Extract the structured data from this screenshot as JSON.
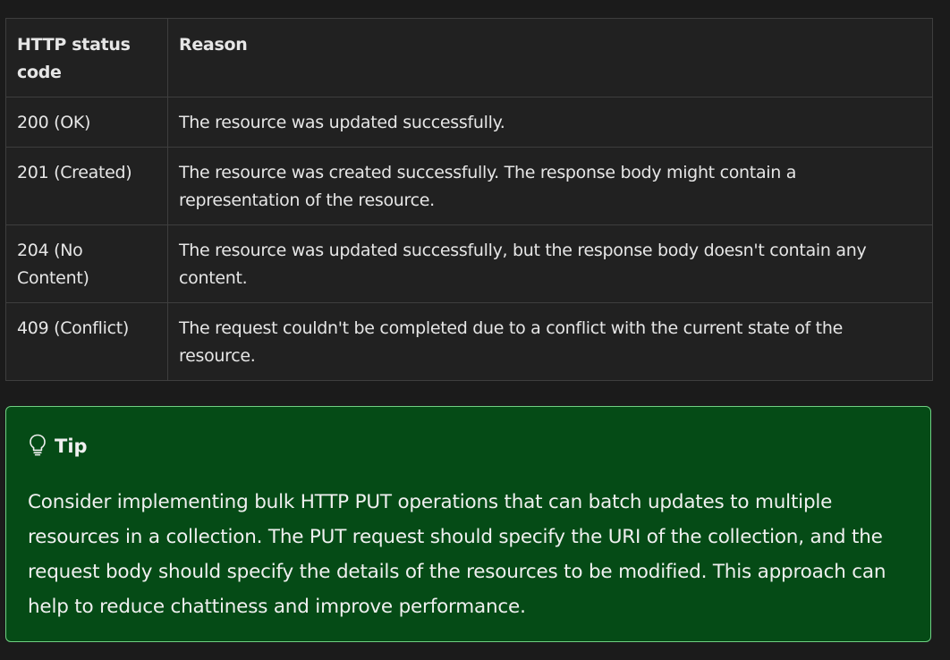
{
  "table": {
    "headers": {
      "code": "HTTP status code",
      "reason": "Reason"
    },
    "rows": [
      {
        "code": "200 (OK)",
        "reason": "The resource was updated successfully."
      },
      {
        "code": "201 (Created)",
        "reason": "The resource was created successfully. The response body might contain a representation of the resource."
      },
      {
        "code": "204 (No Content)",
        "reason": "The resource was updated successfully, but the response body doesn't contain any content."
      },
      {
        "code": "409 (Conflict)",
        "reason": "The request couldn't be completed due to a conflict with the current state of the resource."
      }
    ]
  },
  "tip": {
    "icon": "lightbulb-icon",
    "title": "Tip",
    "body": "Consider implementing bulk HTTP PUT operations that can batch updates to multiple resources in a collection. The PUT request should specify the URI of the collection, and the request body should specify the details of the resources to be modified. This approach can help to reduce chattiness and improve performance."
  },
  "colors": {
    "page_background": "#1b1b1b",
    "table_background": "#212121",
    "table_border": "#3e3e3e",
    "tip_background": "#054b16",
    "tip_border": "#6fcf82"
  }
}
